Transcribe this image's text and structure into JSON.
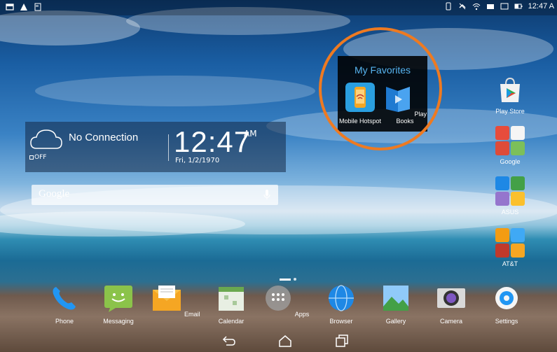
{
  "status_bar": {
    "time": "12:47 A"
  },
  "weather_widget": {
    "condition": "No Connection",
    "off_label": "OFF",
    "time": "12:47",
    "ampm": "AM",
    "date": "Fri, 1/2/1970"
  },
  "search_bar": {
    "placeholder": "Google"
  },
  "favorites_folder": {
    "title": "My Favorites",
    "items": [
      {
        "label": "Mobile Hotspot",
        "icon": "mobile-hotspot-icon"
      },
      {
        "label": "Play Books",
        "icon": "play-books-icon"
      }
    ],
    "highlight_color": "#ee7a21"
  },
  "right_column": [
    {
      "label": "Play Store",
      "icon": "play-store-icon"
    },
    {
      "label": "Google",
      "icon": "google-folder-icon"
    },
    {
      "label": "ASUS",
      "icon": "asus-folder-icon"
    },
    {
      "label": "AT&T",
      "icon": "att-folder-icon"
    }
  ],
  "dock": [
    {
      "label": "Phone",
      "icon": "phone-icon"
    },
    {
      "label": "Messaging",
      "icon": "messaging-icon"
    },
    {
      "label": "Email",
      "icon": "email-icon"
    },
    {
      "label": "Calendar",
      "icon": "calendar-icon"
    },
    {
      "label": "Apps",
      "icon": "apps-icon"
    },
    {
      "label": "Browser",
      "icon": "browser-icon"
    },
    {
      "label": "Gallery",
      "icon": "gallery-icon"
    },
    {
      "label": "Camera",
      "icon": "camera-icon"
    },
    {
      "label": "Settings",
      "icon": "settings-icon"
    }
  ],
  "navigation": [
    "back-icon",
    "home-icon",
    "recents-icon"
  ]
}
